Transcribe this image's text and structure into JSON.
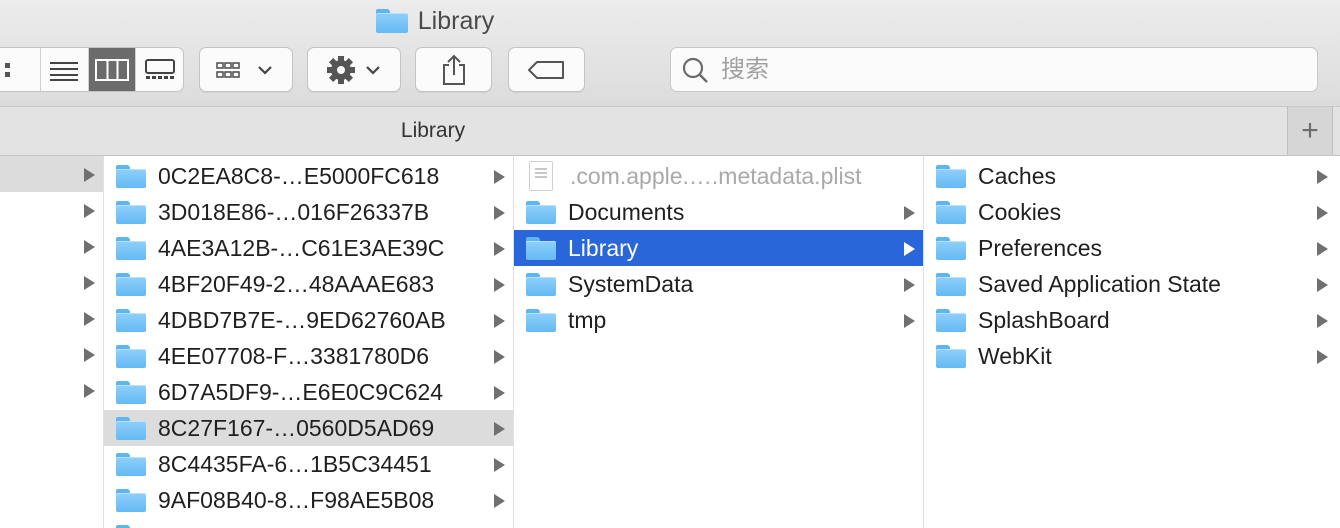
{
  "window": {
    "title": "Library"
  },
  "toolbar": {
    "view_modes": [
      "icon-view",
      "list-view",
      "column-view",
      "gallery-view"
    ],
    "active_view": "column-view",
    "group_button": "group-by",
    "action_button": "action",
    "share_button": "share",
    "tags_button": "tags",
    "search_placeholder": "搜索"
  },
  "tabbar": {
    "label": "Library",
    "add_label": "+"
  },
  "columns": {
    "col2": [
      {
        "name": "0C2EA8C8-…E5000FC618"
      },
      {
        "name": "3D018E86-…016F26337B"
      },
      {
        "name": "4AE3A12B-…C61E3AE39C"
      },
      {
        "name": "4BF20F49-2…48AAAE683"
      },
      {
        "name": "4DBD7B7E-…9ED62760AB"
      },
      {
        "name": "4EE07708-F…3381780D6"
      },
      {
        "name": "6D7A5DF9-…E6E0C9C624"
      },
      {
        "name": "8C27F167-…0560D5AD69"
      },
      {
        "name": "8C4435FA-6…1B5C34451"
      },
      {
        "name": "9AF08B40-8…F98AE5B08"
      }
    ],
    "col3": [
      {
        "name": ".com.apple.….metadata.plist"
      },
      {
        "name": "Documents"
      },
      {
        "name": "Library"
      },
      {
        "name": "SystemData"
      },
      {
        "name": "tmp"
      }
    ],
    "col4": [
      {
        "name": "Caches"
      },
      {
        "name": "Cookies"
      },
      {
        "name": "Preferences"
      },
      {
        "name": "Saved Application State"
      },
      {
        "name": "SplashBoard"
      },
      {
        "name": "WebKit"
      }
    ]
  }
}
